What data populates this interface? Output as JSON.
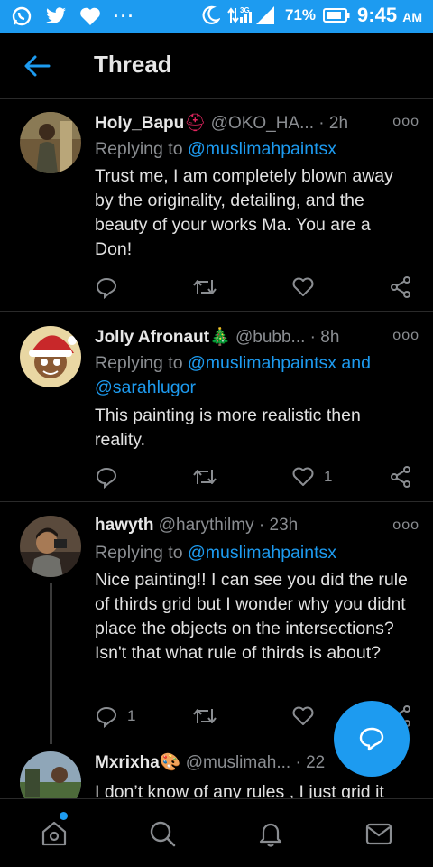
{
  "status_bar": {
    "battery": "71%",
    "time": "9:45",
    "ampm": "AM",
    "network": "3G",
    "dots": "···"
  },
  "header": {
    "title": "Thread"
  },
  "tweets": [
    {
      "name": "Holy_Bapu",
      "emoji": "⛑",
      "handle": "@OKO_HA...",
      "time": "· 2h",
      "replying_label": "Replying to",
      "mentions": "@muslimahpaintsx",
      "body": "Trust me, I am completely blown away by the originality, detailing, and the beauty of your works Ma. You are a Don!",
      "reply_count": "",
      "retweet_count": "",
      "like_count": ""
    },
    {
      "name": "Jolly Afronaut",
      "emoji": "🎄",
      "handle": "@bubb...",
      "time": "· 8h",
      "replying_label": "Replying to",
      "mentions": "@muslimahpaintsx and @sarahlugor",
      "body": "This painting is more realistic then reality.",
      "reply_count": "",
      "retweet_count": "",
      "like_count": "1"
    },
    {
      "name": "hawyth",
      "emoji": "",
      "handle": "@harythilmy",
      "time": "· 23h",
      "replying_label": "Replying to",
      "mentions": "@muslimahpaintsx",
      "body": "Nice painting!! I can see you did the rule of thirds grid but I wonder why you didnt place the objects on the intersections? Isn't that what rule of thirds is about?",
      "reply_count": "1",
      "retweet_count": "",
      "like_count": ""
    },
    {
      "name": "Mxrixha",
      "emoji": "🎨",
      "handle": "@muslimah...",
      "time": "· 22",
      "body": "I don’t know of any rules , I just grid it"
    }
  ],
  "icons": {
    "reply": "reply-icon",
    "retweet": "retweet-icon",
    "like": "heart-icon",
    "share": "share-icon",
    "compose": "compose-reply-icon"
  },
  "colors": {
    "accent": "#1d9bf0",
    "background": "#000000",
    "muted": "#8a8d91"
  }
}
